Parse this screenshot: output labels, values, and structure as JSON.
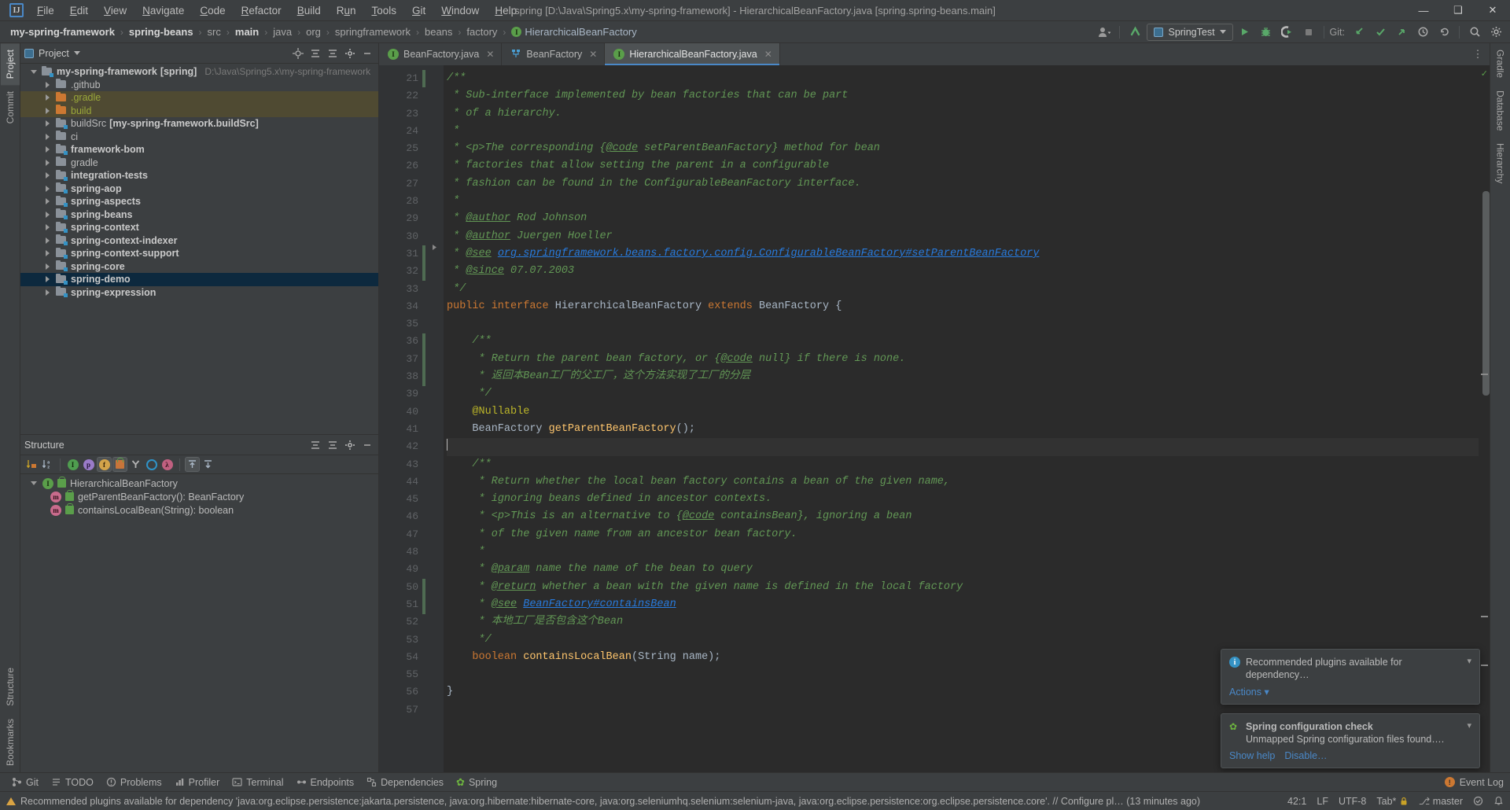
{
  "window": {
    "title": "spring [D:\\Java\\Spring5.x\\my-spring-framework] - HierarchicalBeanFactory.java [spring.spring-beans.main]",
    "minimize": "—",
    "maximize": "❑",
    "close": "✕",
    "logo": "IJ"
  },
  "menu": {
    "items": [
      {
        "label": "File"
      },
      {
        "label": "Edit"
      },
      {
        "label": "View"
      },
      {
        "label": "Navigate"
      },
      {
        "label": "Code"
      },
      {
        "label": "Refactor"
      },
      {
        "label": "Build"
      },
      {
        "label": "Run"
      },
      {
        "label": "Tools"
      },
      {
        "label": "Git"
      },
      {
        "label": "Window"
      },
      {
        "label": "Help"
      }
    ]
  },
  "breadcrumb": {
    "items": [
      {
        "label": "my-spring-framework",
        "style": "bold"
      },
      {
        "label": "spring-beans",
        "style": "bold"
      },
      {
        "label": "src",
        "style": "plain"
      },
      {
        "label": "main",
        "style": "bold"
      },
      {
        "label": "java",
        "style": "plain"
      },
      {
        "label": "org",
        "style": "plain"
      },
      {
        "label": "springframework",
        "style": "plain"
      },
      {
        "label": "beans",
        "style": "plain"
      },
      {
        "label": "factory",
        "style": "plain"
      }
    ],
    "current_file": "HierarchicalBeanFactory",
    "current_badge": "I",
    "separator": "›"
  },
  "toolbar": {
    "run_config": "SpringTest",
    "git_label": "Git:",
    "icons": [
      "user-avatar-icon",
      "update-project-icon",
      "run-icon",
      "debug-icon",
      "run-with-coverage-icon",
      "stop-icon",
      "search-everywhere-icon",
      "settings-icon"
    ]
  },
  "left_strip": {
    "tabs": [
      {
        "label": "Project",
        "name": "project",
        "active": true
      },
      {
        "label": "Commit",
        "name": "commit",
        "active": false
      }
    ],
    "bottom_tabs": [
      {
        "label": "Structure",
        "name": "structure"
      },
      {
        "label": "Bookmarks",
        "name": "bookmarks"
      }
    ]
  },
  "right_strip": {
    "tabs": [
      {
        "label": "Gradle",
        "name": "gradle"
      },
      {
        "label": "Database",
        "name": "database"
      },
      {
        "label": "Hierarchy",
        "name": "hierarchy"
      }
    ]
  },
  "project_panel": {
    "title": "Project",
    "dropdown_caret": "▾",
    "actions": [
      "locate-icon",
      "expand-all-icon",
      "collapse-all-icon",
      "settings-icon",
      "hide-icon"
    ],
    "tree": [
      {
        "indent": 0,
        "arrow": "down",
        "label": "my-spring-framework",
        "suffix": "[spring]",
        "path": "D:\\Java\\Spring5.x\\my-spring-framework",
        "icon": "module",
        "state": "normal",
        "bold": true
      },
      {
        "indent": 1,
        "arrow": "right",
        "label": ".github",
        "icon": "folder",
        "state": "normal"
      },
      {
        "indent": 1,
        "arrow": "right",
        "label": ".gradle",
        "icon": "folder-excluded",
        "state": "highlight"
      },
      {
        "indent": 1,
        "arrow": "right",
        "label": "build",
        "icon": "folder-excluded",
        "state": "highlight"
      },
      {
        "indent": 1,
        "arrow": "right",
        "label": "buildSrc",
        "suffix": "[my-spring-framework.buildSrc]",
        "icon": "module",
        "state": "normal"
      },
      {
        "indent": 1,
        "arrow": "right",
        "label": "ci",
        "icon": "folder",
        "state": "normal"
      },
      {
        "indent": 1,
        "arrow": "right",
        "label": "framework-bom",
        "icon": "module",
        "state": "normal",
        "bold": true
      },
      {
        "indent": 1,
        "arrow": "right",
        "label": "gradle",
        "icon": "folder",
        "state": "normal"
      },
      {
        "indent": 1,
        "arrow": "right",
        "label": "integration-tests",
        "icon": "module",
        "state": "normal",
        "bold": true
      },
      {
        "indent": 1,
        "arrow": "right",
        "label": "spring-aop",
        "icon": "module",
        "state": "normal",
        "bold": true
      },
      {
        "indent": 1,
        "arrow": "right",
        "label": "spring-aspects",
        "icon": "module",
        "state": "normal",
        "bold": true
      },
      {
        "indent": 1,
        "arrow": "right",
        "label": "spring-beans",
        "icon": "module",
        "state": "normal",
        "bold": true
      },
      {
        "indent": 1,
        "arrow": "right",
        "label": "spring-context",
        "icon": "module",
        "state": "normal",
        "bold": true
      },
      {
        "indent": 1,
        "arrow": "right",
        "label": "spring-context-indexer",
        "icon": "module",
        "state": "normal",
        "bold": true
      },
      {
        "indent": 1,
        "arrow": "right",
        "label": "spring-context-support",
        "icon": "module",
        "state": "normal",
        "bold": true
      },
      {
        "indent": 1,
        "arrow": "right",
        "label": "spring-core",
        "icon": "module",
        "state": "normal",
        "bold": true
      },
      {
        "indent": 1,
        "arrow": "right",
        "label": "spring-demo",
        "icon": "module",
        "state": "selected",
        "bold": true
      },
      {
        "indent": 1,
        "arrow": "right",
        "label": "spring-expression",
        "icon": "module",
        "state": "normal",
        "bold": true
      }
    ]
  },
  "structure_panel": {
    "title": "Structure",
    "actions": [
      "expand-all-icon",
      "collapse-all-icon",
      "settings-icon",
      "hide-icon"
    ],
    "toolbar_icons": [
      "sort-by-visibility-icon",
      "sort-alphabetically-icon",
      "show-inherited-icon",
      "show-properties-icon",
      "show-fields-icon",
      "show-non-public-icon",
      "show-anonymous-icon",
      "group-methods-icon",
      "show-lambdas-icon",
      "autoscroll-to-source-icon",
      "autoscroll-from-source-icon"
    ],
    "rows": [
      {
        "indent": 0,
        "arrow": "down",
        "badge": "I",
        "badge_color": "#5a9e4a",
        "label": "HierarchicalBeanFactory"
      },
      {
        "indent": 1,
        "arrow": "none",
        "badge": "m",
        "badge_color": "#c96b8c",
        "label": "getParentBeanFactory(): BeanFactory"
      },
      {
        "indent": 1,
        "arrow": "none",
        "badge": "m",
        "badge_color": "#c96b8c",
        "label": "containsLocalBean(String): boolean"
      }
    ]
  },
  "editor": {
    "tabs": [
      {
        "label": "BeanFactory.java",
        "icon": "interface-icon",
        "active": false,
        "close": "✕"
      },
      {
        "label": "BeanFactory",
        "icon": "hierarchy-icon",
        "active": false,
        "close": "✕"
      },
      {
        "label": "HierarchicalBeanFactory.java",
        "icon": "interface-icon",
        "active": true,
        "close": "✕"
      }
    ],
    "first_line_number": 21,
    "lines": [
      {
        "n": 21,
        "html": "<span class='cm'>/**</span>",
        "fold": "start"
      },
      {
        "n": 22,
        "html": "<span class='cm'> * Sub-interface implemented by bean factories that can be part</span>"
      },
      {
        "n": 23,
        "html": "<span class='cm'> * of a hierarchy.</span>"
      },
      {
        "n": 24,
        "html": "<span class='cm'> *</span>"
      },
      {
        "n": 25,
        "html": "<span class='cm'> * &lt;p&gt;The corresponding {</span><span class='cm-tag'>@code</span><span class='cm'> setParentBeanFactory} method for bean</span>"
      },
      {
        "n": 26,
        "html": "<span class='cm'> * factories that allow setting the parent in a configurable</span>"
      },
      {
        "n": 27,
        "html": "<span class='cm'> * fashion can be found in the ConfigurableBeanFactory interface.</span>"
      },
      {
        "n": 28,
        "html": "<span class='cm'> *</span>"
      },
      {
        "n": 29,
        "html": "<span class='cm'> * </span><span class='cm-tag'>@author</span><span class='cm'> Rod Johnson</span>"
      },
      {
        "n": 30,
        "html": "<span class='cm'> * </span><span class='cm-tag'>@author</span><span class='cm'> Juergen Hoeller</span>"
      },
      {
        "n": 31,
        "html": "<span class='cm'> * </span><span class='cm-tag'>@see</span><span class='cm'> </span><span class='cm-link'>org.springframework.beans.factory.config.ConfigurableBeanFactory#setParentBeanFactory</span>"
      },
      {
        "n": 32,
        "html": "<span class='cm'> * </span><span class='cm-tag'>@since</span><span class='cm'> 07.07.2003</span>"
      },
      {
        "n": 33,
        "html": "<span class='cm'> */</span>"
      },
      {
        "n": 34,
        "html": "<span class='kw'>public interface </span><span class='ty'>HierarchicalBeanFactory </span><span class='kw'>extends </span><span class='ty'>BeanFactory </span><span class='pl'>{</span>"
      },
      {
        "n": 35,
        "html": ""
      },
      {
        "n": 36,
        "html": "    <span class='cm'>/**</span>"
      },
      {
        "n": 37,
        "html": "     <span class='cm'>* Return the parent bean factory, or {</span><span class='cm-tag'>@code</span><span class='cm'> null} if there is none.</span>"
      },
      {
        "n": 38,
        "html": "     <span class='cm'>* 返回本Bean工厂的父工厂，这个方法实现了工厂的分层</span>"
      },
      {
        "n": 39,
        "html": "     <span class='cm'>*/</span>"
      },
      {
        "n": 40,
        "html": "    <span class='ann'>@Nullable</span>"
      },
      {
        "n": 41,
        "html": "    <span class='ty'>BeanFactory </span><span class='mth'>getParentBeanFactory</span><span class='pl'>();</span>"
      },
      {
        "n": 42,
        "html": "",
        "caret": true
      },
      {
        "n": 43,
        "html": "    <span class='cm'>/**</span>"
      },
      {
        "n": 44,
        "html": "     <span class='cm'>* Return whether the local bean factory contains a bean of the given name,</span>"
      },
      {
        "n": 45,
        "html": "     <span class='cm'>* ignoring beans defined in ancestor contexts.</span>"
      },
      {
        "n": 46,
        "html": "     <span class='cm'>* &lt;p&gt;This is an alternative to {</span><span class='cm-tag'>@code</span><span class='cm'> containsBean}, ignoring a bean</span>"
      },
      {
        "n": 47,
        "html": "     <span class='cm'>* of the given name from an ancestor bean factory.</span>"
      },
      {
        "n": 48,
        "html": "     <span class='cm'>*</span>"
      },
      {
        "n": 49,
        "html": "     <span class='cm'>* </span><span class='cm-tag'>@param</span><span class='cm'> name the name of the bean to query</span>"
      },
      {
        "n": 50,
        "html": "     <span class='cm'>* </span><span class='cm-tag'>@return</span><span class='cm'> whether a bean with the given name is defined in the local factory</span>"
      },
      {
        "n": 51,
        "html": "     <span class='cm'>* </span><span class='cm-tag'>@see</span><span class='cm'> </span><span class='cm-link'>BeanFactory#containsBean</span>"
      },
      {
        "n": 52,
        "html": "     <span class='cm'>* 本地工厂是否包含这个Bean</span>"
      },
      {
        "n": 53,
        "html": "     <span class='cm'>*/</span>"
      },
      {
        "n": 54,
        "html": "    <span class='kw'>boolean </span><span class='mth'>containsLocalBean</span><span class='pl'>(</span><span class='ty'>String </span><span class='pl'>name);</span>"
      },
      {
        "n": 55,
        "html": ""
      },
      {
        "n": 56,
        "html": "<span class='pl'>}</span>"
      },
      {
        "n": 57,
        "html": ""
      }
    ]
  },
  "notifications": [
    {
      "icon": "info-icon",
      "text": "Recommended plugins available for dependency…",
      "links": [
        "Actions ▾"
      ]
    },
    {
      "icon": "spring-leaf-icon",
      "title": "Spring configuration check",
      "text": "Unmapped Spring configuration files found….",
      "links": [
        "Show help",
        "Disable…"
      ]
    }
  ],
  "bottom_toolwindows": {
    "items": [
      {
        "label": "Git",
        "icon": "git-icon"
      },
      {
        "label": "TODO",
        "icon": "todo-icon"
      },
      {
        "label": "Problems",
        "icon": "problems-icon"
      },
      {
        "label": "Profiler",
        "icon": "profiler-icon"
      },
      {
        "label": "Terminal",
        "icon": "terminal-icon"
      },
      {
        "label": "Endpoints",
        "icon": "endpoints-icon"
      },
      {
        "label": "Dependencies",
        "icon": "dependencies-icon"
      },
      {
        "label": "Spring",
        "icon": "spring-icon"
      }
    ],
    "event_log": "Event Log"
  },
  "statusbar": {
    "message": "Recommended plugins available for dependency 'java:org.eclipse.persistence:jakarta.persistence, java:org.hibernate:hibernate-core, java:org.seleniumhq.selenium:selenium-java, java:org.eclipse.persistence:org.eclipse.persistence.core'. // Configure pl… (13 minutes ago)",
    "caret_position": "42:1",
    "line_separator": "LF",
    "encoding": "UTF-8",
    "indent": "Tab*",
    "branch": "master",
    "lock_icon": "read-only-icon",
    "inspection_icon": "inspections-icon"
  },
  "colors": {
    "accent": "#4a88c7",
    "editor_bg": "#2b2b2b",
    "panel_bg": "#3c3f41",
    "gutter_bg": "#313335",
    "selection": "#0d293e",
    "comment": "#629755",
    "keyword": "#cc7832",
    "annotation": "#bbb529",
    "method": "#ffc66d",
    "link": "#287bde",
    "excluded": "#4f4a32"
  }
}
